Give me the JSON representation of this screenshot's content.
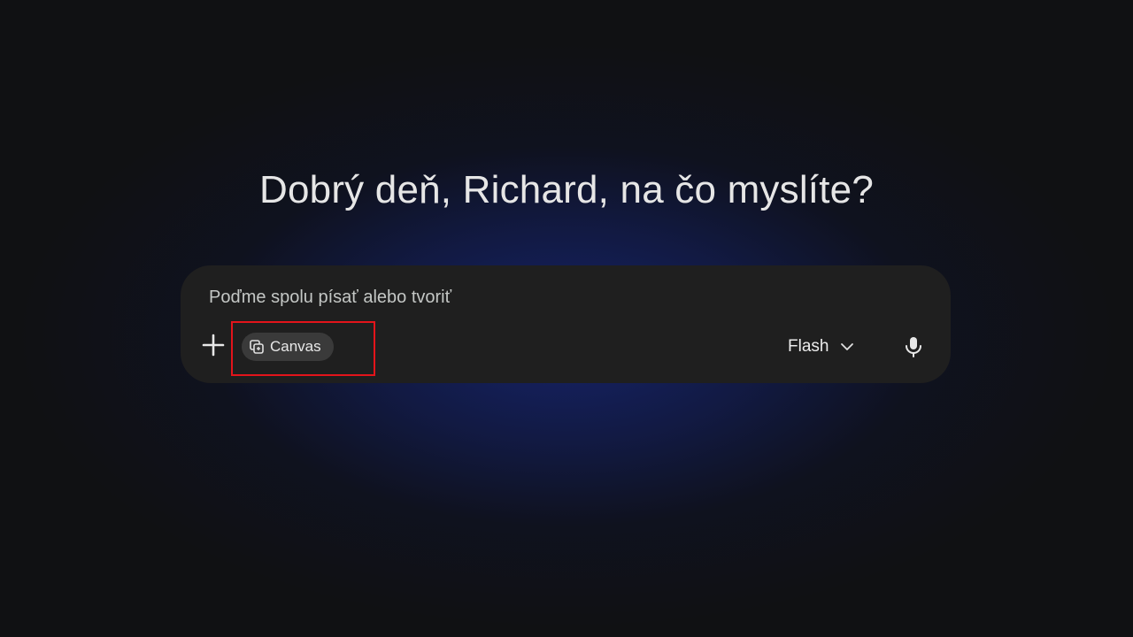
{
  "greeting": {
    "text": "Dobrý deň, Richard, na čo myslíte?"
  },
  "composer": {
    "placeholder": "Poďme spolu písať alebo tvoriť",
    "value": "",
    "tools": {
      "add_icon": "plus-icon",
      "canvas_chip": {
        "label": "Canvas",
        "icon": "canvas-icon"
      }
    },
    "model_picker": {
      "selected": "Flash",
      "icon": "chevron-down-icon"
    },
    "mic_icon": "microphone-icon"
  },
  "colors": {
    "background": "#101113",
    "glow": "#16246e",
    "composer_bg": "#1f1f1f",
    "chip_bg": "#3a3a3a",
    "highlight": "#e3141b",
    "text": "#e3e3e3"
  }
}
